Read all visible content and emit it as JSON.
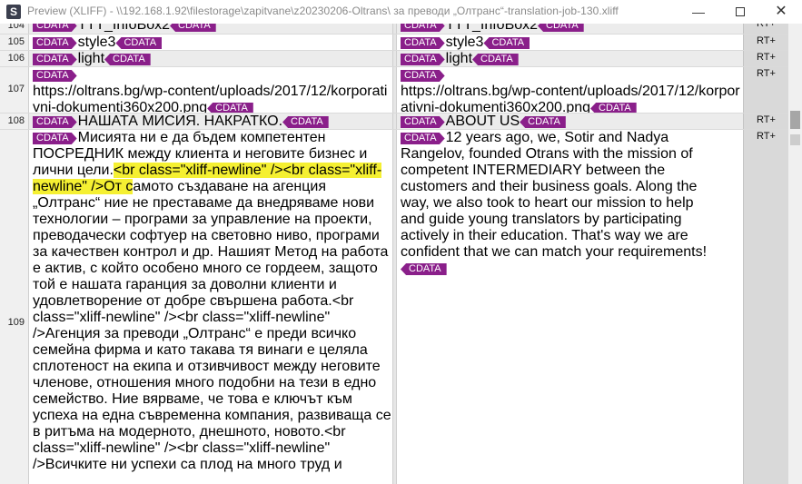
{
  "window": {
    "app_icon_letter": "S",
    "title": "Preview (XLIFF) - \\\\192.168.1.92\\filestorage\\zapitvane\\z20230206-Oltrans\\ за преводи „Олтранс“-translation-job-130.xliff",
    "min_label": "—",
    "close_label": "✕"
  },
  "tag_label": "CDATA",
  "status_label": "RT+",
  "rows": {
    "r104": {
      "num": "104",
      "src_text": "TTT_InfoBox2",
      "tgt_text": "TTT_InfoBox2"
    },
    "r105": {
      "num": "105",
      "src_text": "style3",
      "tgt_text": "style3"
    },
    "r106": {
      "num": "106",
      "src_text": "light",
      "tgt_text": "light"
    },
    "r107": {
      "num": "107",
      "src_text": "https://oltrans.bg/wp-content/uploads/2017/12/korporativni-dokumenti360x200.png",
      "tgt_text": "https://oltrans.bg/wp-content/uploads/2017/12/korporativni-dokumenti360x200.png"
    },
    "r108": {
      "num": "108",
      "src_text": "НАШАТА МИСИЯ. НАКРАТКО.",
      "tgt_text": "ABOUT US"
    },
    "r109": {
      "num": "109",
      "src_a": "Мисията ни е да бъдем компетентен ПОСРЕДНИК между клиента и неговите бизнес и лични цели.",
      "src_hl": "<br class=\"xliff-newline\" /><br class=\"xliff-newline\" />От с",
      "src_b": "амото създаване на агенция „Олтранс“ ние не преставаме да внедряваме нови технологии – програми за управление на проекти, преводачески софтуер на световно ниво, програми за качествен контрол и др. Нашият Метод на работа е актив, с който особено много се гордеем, защото той е нашата гаранция за доволни клиенти и удовлетворение от добре свършена работа.<br class=\"xliff-newline\" /><br class=\"xliff-newline\" />Агенция за преводи „Олтранс“ е преди всичко семейна фирма и като такава тя винаги е целяла сплотеност на екипа и отзивчивост между неговите членове, отношения много подобни на тези в едно семейство. Ние вярваме, че това е ключът към успеха на една съвременна компания, развиваща се в ритъма на модерното, днешното, новото.<br class=\"xliff-newline\" /><br class=\"xliff-newline\" />Всичките ни успехи са плод на много труд и",
      "tgt_text": "12 years ago, we, Sotir and Nadya Rangelov, founded Otrans with the mission of competent INTERMEDIARY between the customers and their business goals. Along the way, we also took to heart our mission to help and guide young translators by participating actively in their education. That's way we are confident that we can match your requirements!"
    }
  }
}
